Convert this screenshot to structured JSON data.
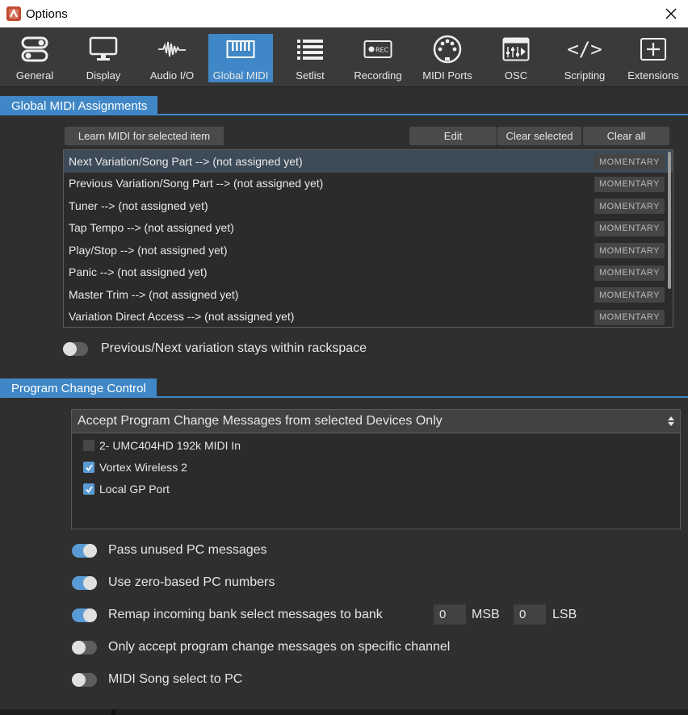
{
  "window": {
    "title": "Options"
  },
  "toolbar": [
    {
      "label": "General",
      "icon": "general-icon"
    },
    {
      "label": "Display",
      "icon": "display-icon"
    },
    {
      "label": "Audio I/O",
      "icon": "audio-waveform-icon"
    },
    {
      "label": "Global MIDI",
      "icon": "midi-keyboard-icon",
      "active": true
    },
    {
      "label": "Setlist",
      "icon": "list-icon"
    },
    {
      "label": "Recording",
      "icon": "rec-icon",
      "icon_text": "REC"
    },
    {
      "label": "MIDI Ports",
      "icon": "midi-port-icon"
    },
    {
      "label": "OSC",
      "icon": "osc-icon"
    },
    {
      "label": "Scripting",
      "icon": "code-icon",
      "icon_text": "</>"
    },
    {
      "label": "Extensions",
      "icon": "plus-box-icon"
    }
  ],
  "global_midi": {
    "section_title": "Global MIDI Assignments",
    "learn_button": "Learn MIDI for selected item",
    "edit_button": "Edit",
    "clear_selected_button": "Clear selected",
    "clear_all_button": "Clear all",
    "rows": [
      {
        "label": "Next Variation/Song Part --> (not assigned yet)",
        "mode": "MOMENTARY"
      },
      {
        "label": "Previous Variation/Song Part --> (not assigned yet)",
        "mode": "MOMENTARY"
      },
      {
        "label": "Tuner --> (not assigned yet)",
        "mode": "MOMENTARY"
      },
      {
        "label": "Tap Tempo --> (not assigned yet)",
        "mode": "MOMENTARY"
      },
      {
        "label": "Play/Stop --> (not assigned yet)",
        "mode": "MOMENTARY"
      },
      {
        "label": "Panic --> (not assigned yet)",
        "mode": "MOMENTARY"
      },
      {
        "label": "Master Trim --> (not assigned yet)",
        "mode": "MOMENTARY"
      },
      {
        "label": "Variation Direct Access --> (not assigned yet)",
        "mode": "MOMENTARY"
      }
    ],
    "stays_within_rackspace": {
      "label": "Previous/Next variation stays within rackspace",
      "on": false
    }
  },
  "program_change": {
    "section_title": "Program Change Control",
    "mode_select": "Accept Program Change Messages from selected Devices Only",
    "devices": [
      {
        "label": "2- UMC404HD 192k MIDI In",
        "checked": false
      },
      {
        "label": "Vortex Wireless 2",
        "checked": true
      },
      {
        "label": "Local GP Port",
        "checked": true
      }
    ],
    "options": [
      {
        "label": "Pass unused PC messages",
        "on": true
      },
      {
        "label": "Use zero-based PC numbers",
        "on": true
      },
      {
        "label": "Remap incoming bank select messages  to bank",
        "on": true
      },
      {
        "label": "Only accept program change messages on specific channel",
        "on": false
      },
      {
        "label": "MIDI Song select to PC",
        "on": false
      }
    ],
    "bank": {
      "msb_value": "0",
      "msb_label": "MSB",
      "lsb_value": "0",
      "lsb_label": "LSB"
    }
  },
  "colors": {
    "accent": "#3f87c6",
    "toggle_on": "#5b9bd5",
    "background": "#2f2f2f",
    "app_icon": "#c4492e"
  }
}
